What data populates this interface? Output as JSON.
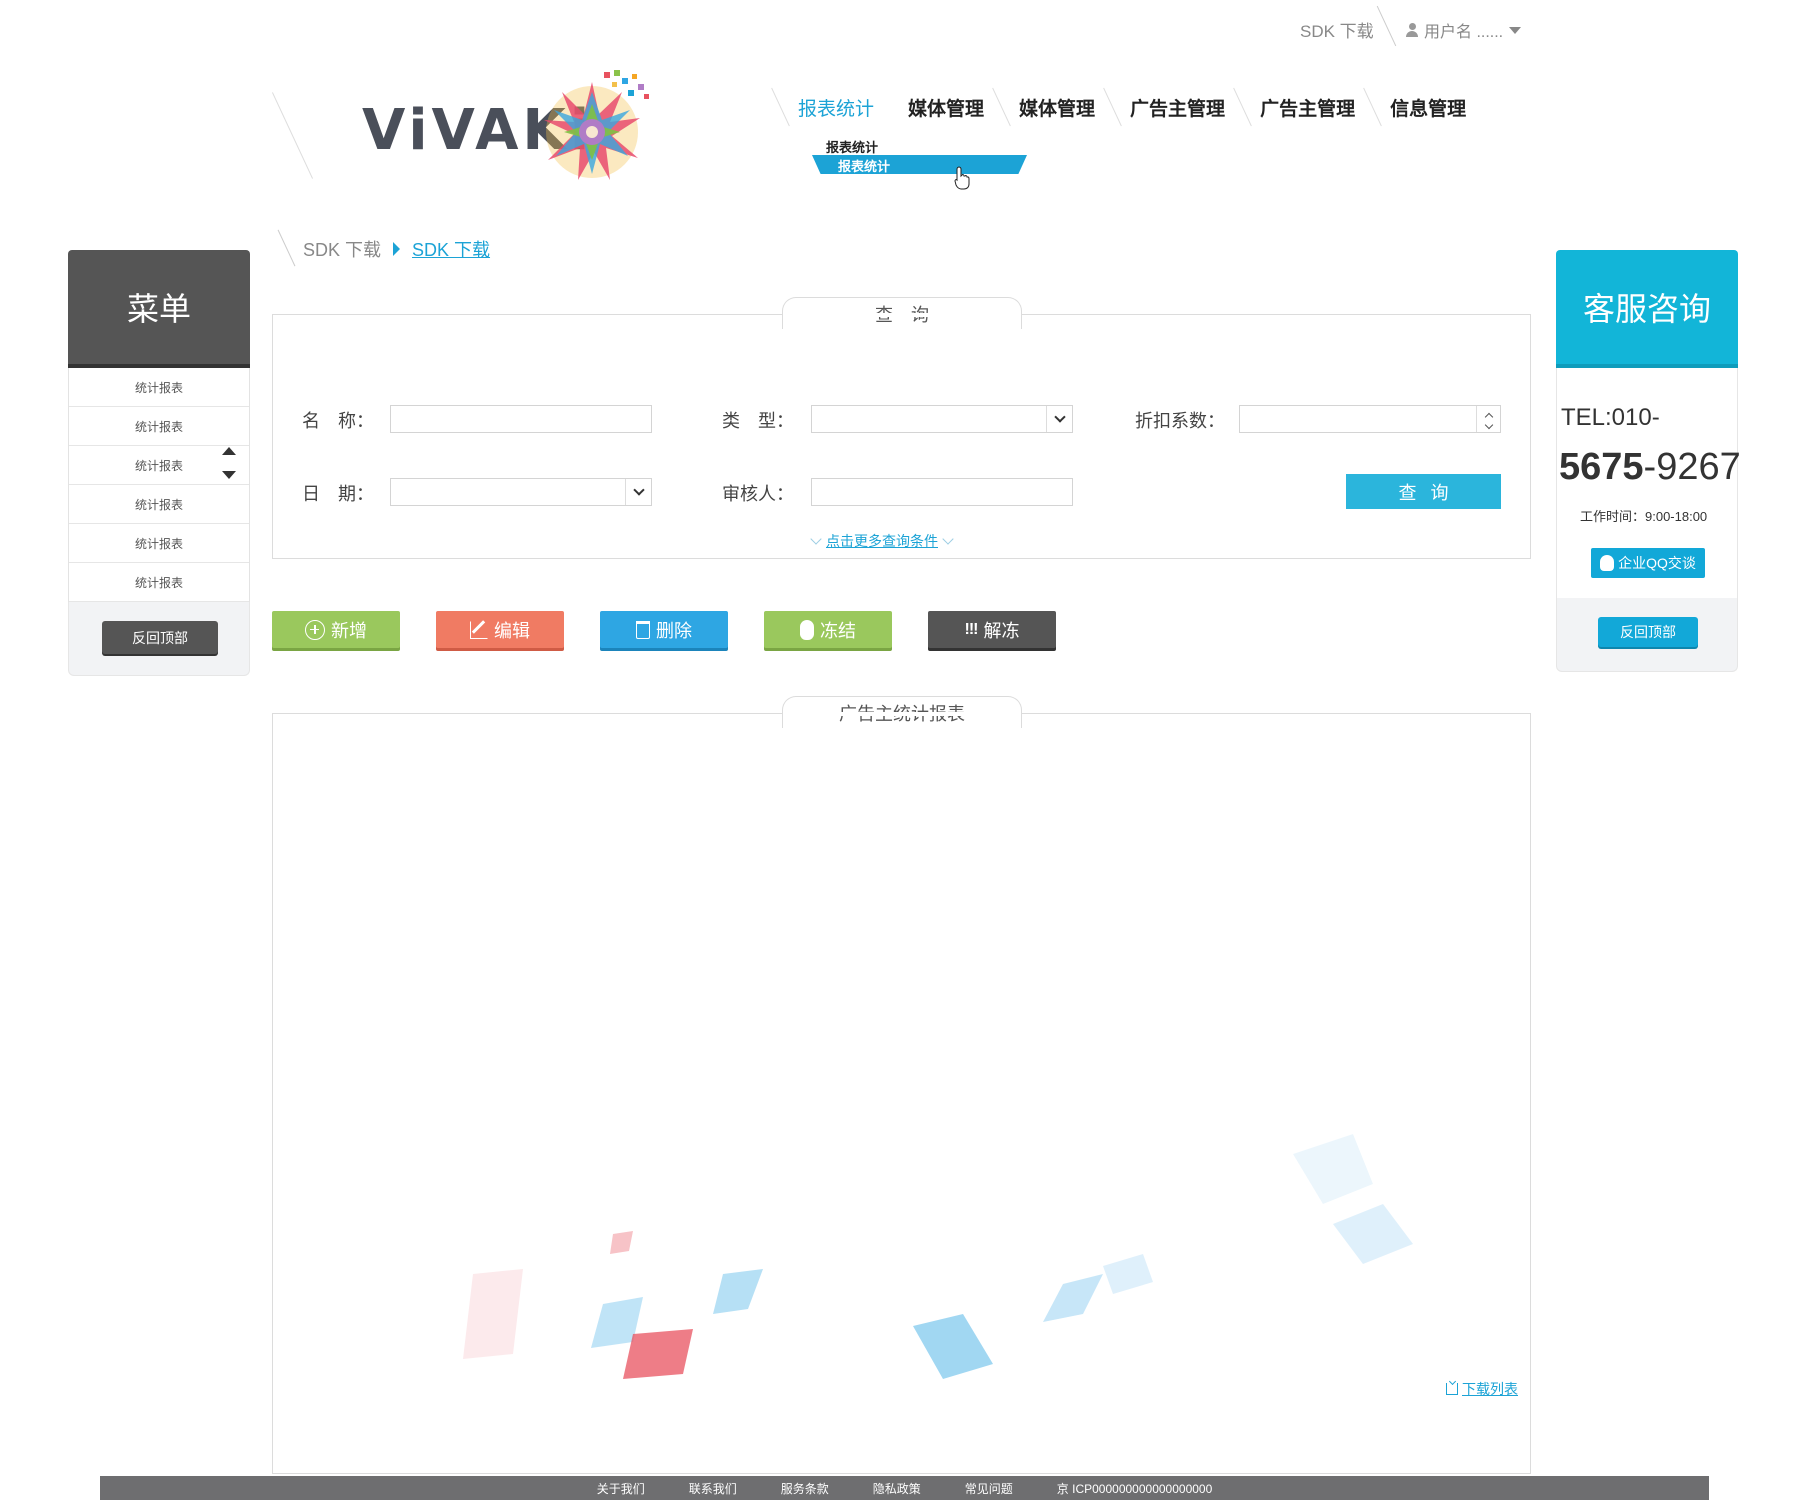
{
  "topbar": {
    "sdk_download": "SDK 下载",
    "username": "用户名 ......"
  },
  "logo": {
    "text": "ViVAKi"
  },
  "nav": {
    "items": [
      {
        "label": "报表统计",
        "active": true
      },
      {
        "label": "媒体管理"
      },
      {
        "label": "媒体管理"
      },
      {
        "label": "广告主管理"
      },
      {
        "label": "广告主管理"
      },
      {
        "label": "信息管理"
      }
    ],
    "submenu": {
      "title": "报表统计",
      "highlighted": "报表统计"
    }
  },
  "breadcrumb": {
    "parent": "SDK 下载",
    "current": "SDK 下载"
  },
  "left_menu": {
    "title": "菜单",
    "items": [
      "统计报表",
      "统计报表",
      "统计报表",
      "统计报表",
      "统计报表",
      "统计报表"
    ],
    "back_to_top": "反回顶部"
  },
  "support": {
    "title": "客服咨询",
    "tel_label": "TEL:010-",
    "tel_bold": "5675",
    "tel_rest": "-9267",
    "hours": "工作时间：9:00-18:00",
    "qq_button": "企业QQ交谈",
    "back_to_top": "反回顶部"
  },
  "query_panel": {
    "title": "查　询",
    "fields": {
      "name_label": "名　称：",
      "name_value": "",
      "type_label": "类　型：",
      "type_value": "",
      "discount_label": "折扣系数：",
      "discount_value": "",
      "date_label": "日　期：",
      "date_value": "",
      "reviewer_label": "审核人：",
      "reviewer_value": ""
    },
    "search_button": "查询",
    "more_conditions": "点击更多查询条件"
  },
  "actions": {
    "add": "新增",
    "edit": "编辑",
    "delete": "删除",
    "freeze": "冻结",
    "unfreeze_icon": "!!!",
    "unfreeze": "解冻"
  },
  "report_panel": {
    "title": "广告主统计报表",
    "download_list": "下载列表"
  },
  "footer": {
    "links": [
      "关于我们",
      "联系我们",
      "服务条款",
      "隐私政策",
      "常见问题"
    ],
    "icp": "京 ICP000000000000000000"
  },
  "colors": {
    "accent": "#1ca3d6",
    "support_header": "#12b5d8",
    "menu_header": "#555555",
    "green": "#9ac85d",
    "orange": "#f07b63",
    "blue": "#2ea6e3",
    "dark": "#555555",
    "footer": "#6e6e70"
  }
}
